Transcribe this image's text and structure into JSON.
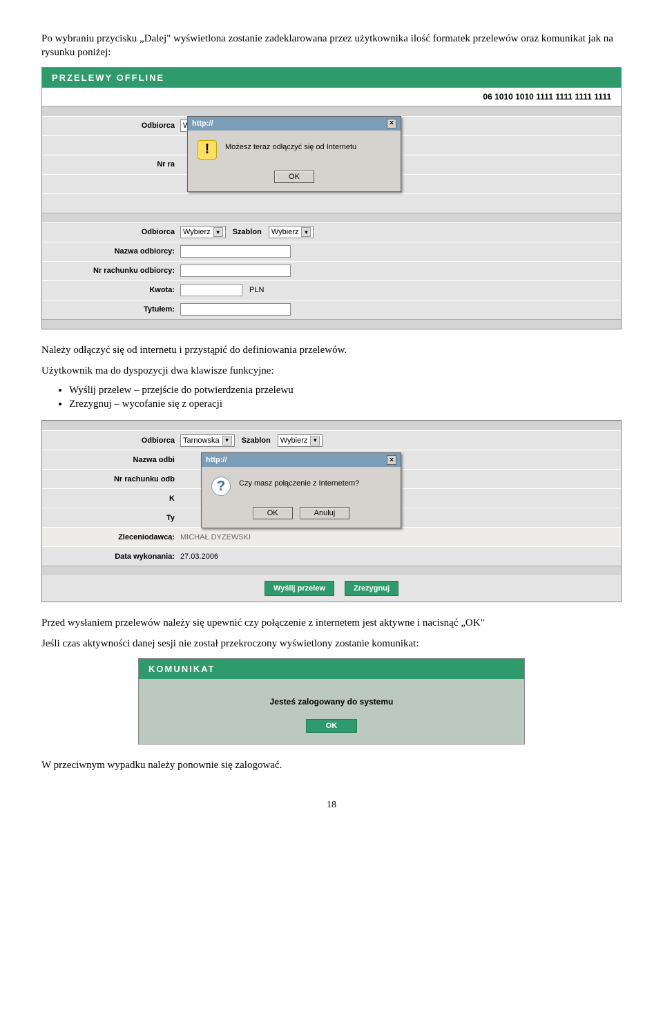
{
  "para1": "Po wybraniu przycisku „Dalej\" wyświetlona zostanie zadeklarowana przez użytkownika ilość formatek przelewów oraz komunikat jak na rysunku poniżej:",
  "para2": "Należy odłączyć się od internetu i przystąpić do definiowania przelewów.",
  "para3": "Użytkownik ma do dyspozycji dwa klawisze funkcyjne:",
  "bullets": {
    "b1": "Wyślij przelew – przejście do potwierdzenia przelewu",
    "b2": "Zrezygnuj – wycofanie się z operacji"
  },
  "para4": "Przed wysłaniem przelewów należy się upewnić czy połączenie z internetem jest aktywne i nacisnąć „OK\"",
  "para5": "Jeśli czas aktywności danej sesji nie został przekroczony wyświetlony zostanie komunikat:",
  "para6": "W przeciwnym wypadku należy ponownie się zalogować.",
  "page_num": "18",
  "s1": {
    "header": "PRZELEWY OFFLINE",
    "acct": "06 1010 1010 1111 1111 1111 1111",
    "lbl_odbiorca": "Odbiorca",
    "lbl_szablon": "Szablon",
    "lbl_nazwa": "Nazwa odbiorcy:",
    "lbl_nrrach": "Nr rachunku odbiorcy:",
    "lbl_nr_short": "Nr ra",
    "lbl_kwota": "Kwota:",
    "lbl_tytulem": "Tytułem:",
    "select_val": "Wybierz",
    "pln": "PLN",
    "dlg_title": "http://",
    "dlg_msg": "Możesz teraz odłączyć się od Internetu",
    "dlg_ok": "OK"
  },
  "s2": {
    "lbl_odbiorca": "Odbiorca",
    "lbl_szablon": "Szablon",
    "sel_odb": "Tarnowska",
    "sel_sza": "Wybierz",
    "lbl_nazwa": "Nazwa odbi",
    "lbl_nrrach": "Nr rachunku odb",
    "lbl_k": "K",
    "lbl_ty": "Ty",
    "lbl_zlec": "Zleceniodawca:",
    "val_zlec": "MICHAŁ DYZEWSKI",
    "lbl_data": "Data wykonania:",
    "val_data": "27.03.2006",
    "dlg_title": "http://",
    "dlg_msg": "Czy masz połączenie z Internetem?",
    "dlg_ok": "OK",
    "dlg_anuluj": "Anuluj",
    "btn_send": "Wyślij przelew",
    "btn_cancel": "Zrezygnuj"
  },
  "s3": {
    "header": "KOMUNIKAT",
    "msg": "Jesteś zalogowany do systemu",
    "ok": "OK"
  }
}
